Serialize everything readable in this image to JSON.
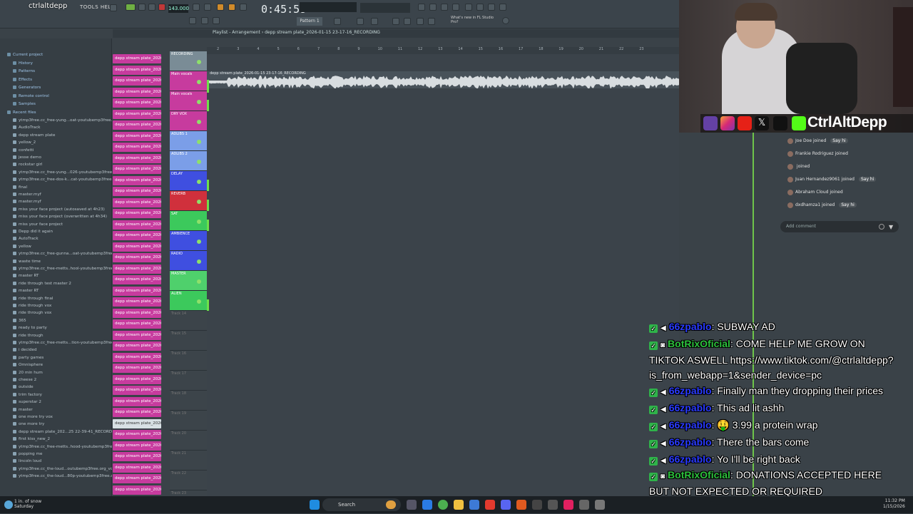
{
  "daw": {
    "logo": "ctrlaltdepp",
    "menu": "TOOLS  HELP",
    "tempo": "143.000",
    "time": "0:45:58",
    "pattern": "Pattern 1",
    "playlist_title": "Playlist - Arrangement › depp stream plate_2026-01-15 23-17-16_RECORDING",
    "news": "What's new in FL Studio Pro?"
  },
  "browser": {
    "folders": [
      "Current project",
      "History",
      "Patterns",
      "Effects",
      "Generators",
      "Remote control",
      "Samples",
      "Recent files"
    ],
    "files": [
      "ytmp3free.cc_free-yung...oat-youtubemp3free.org",
      "AudioTrack",
      "depp stream plate",
      "yellow_2",
      "confetti",
      "jesse demo",
      "rockstar girl",
      "ytmp3free.cc_free-yung...026-youtubemp3free.org",
      "ytmp3free.cc_free-dos-k...cat-youtubemp3free.org",
      "final",
      "master.myf",
      "master.myf",
      "miss your face project (autosaved at 4h23)",
      "miss your face project (overwritten at 4h34)",
      "miss your face project",
      "Depp did it again",
      "AutoTrack",
      "yellow",
      "ytmp3free.cc_free-gunna...oat-youtubemp3free.org",
      "waste time",
      "ytmp3free.cc_free-metts..hool-youtubemp3free.org",
      "master RT",
      "ride through test master 2",
      "master RT",
      "ride through final",
      "ride through vox",
      "ride through vox",
      "365",
      "ready to party",
      "ride through",
      "ytmp3free.cc_free-metts...tion-youtubemp3free.org",
      "i decided",
      "party games",
      "Omnisphere",
      "20 min hum",
      "cheese 2",
      "outside",
      "trim factory",
      "superstar 2",
      "master",
      "one more try vox",
      "one more try",
      "depp stream plate_202...25 22-39-41_RECORDING",
      "first kiss_new_2",
      "ytmp3free.cc_free-metts..hood-youtubemp3free.org",
      "popping me",
      "lincoln loud",
      "ytmp3free.cc_the-loud...outubemp3free.org_vocal",
      "ytmp3free.cc_the-loud...80p-youtubemp3free.org"
    ]
  },
  "clips": {
    "label": "depp stream plate_2026..."
  },
  "tracks": [
    {
      "name": "RECORDING",
      "color": "#7a8c96"
    },
    {
      "name": "Main vocals",
      "color": "#c73b9e"
    },
    {
      "name": "Main vocals",
      "color": "#c73b9e"
    },
    {
      "name": "DRY VOX",
      "color": "#c73b9e"
    },
    {
      "name": "ADLIBS 1",
      "color": "#7b9ee8"
    },
    {
      "name": "ADLIBS 2",
      "color": "#7b9ee8"
    },
    {
      "name": "DELAY",
      "color": "#3f4fe0"
    },
    {
      "name": "REVERB",
      "color": "#d0303c"
    },
    {
      "name": "SAT",
      "color": "#3cc95c"
    },
    {
      "name": "AMBIENCE",
      "color": "#3f4fe0"
    },
    {
      "name": "RADIO",
      "color": "#3f4fe0"
    },
    {
      "name": "MASTER",
      "color": "#4fd06c"
    },
    {
      "name": "ALIEN",
      "color": "#3cc95c"
    }
  ],
  "empty_tracks": [
    "Track 14",
    "Track 15",
    "Track 16",
    "Track 17",
    "Track 18",
    "Track 19",
    "Track 20",
    "Track 21",
    "Track 22",
    "Track 23"
  ],
  "bars": [
    "2",
    "3",
    "4",
    "5",
    "6",
    "7",
    "8",
    "9",
    "10",
    "11",
    "12",
    "13",
    "14",
    "15",
    "16",
    "17",
    "18",
    "19",
    "20",
    "21",
    "22",
    "23"
  ],
  "audio_clip": {
    "label": "depp stream plate_2026-01-15 23-17-16_RECORDING"
  },
  "stream": {
    "handle": "CtrlAltDepp",
    "tiktok_events": [
      {
        "user": "Joe Doe",
        "action": "joined",
        "say": "Say hi"
      },
      {
        "user": "Frankie Rodriguez",
        "action": "joined",
        "say": ""
      },
      {
        "user": "",
        "action": "joined",
        "say": ""
      },
      {
        "user": "Juan Hernandez9061",
        "action": "joined",
        "say": "Say hi"
      },
      {
        "user": "Abraham Cloud",
        "action": "joined",
        "say": ""
      },
      {
        "user": "dxdhamza1",
        "action": "joined",
        "say": "Say hi"
      }
    ],
    "add_comment": "Add comment",
    "chat": [
      {
        "user": "66zpablo",
        "text": ": SUBWAY AD",
        "bot": false
      },
      {
        "user": "BotRixOficial",
        "text": ": COME HELP ME GROW ON TIKTOK ASWELL https://www.tiktok.com/@ctrlaltdepp?is_from_webapp=1&sender_device=pc",
        "bot": true
      },
      {
        "user": "66zpablo",
        "text": ": Finally man they dropping their prices",
        "bot": false
      },
      {
        "user": "66zpablo",
        "text": ": This ad lit ashh",
        "bot": false
      },
      {
        "user": "66zpablo",
        "text": ": 🤑 3.99 a protein wrap",
        "bot": false
      },
      {
        "user": "66zpablo",
        "text": ": There the bars come",
        "bot": false
      },
      {
        "user": "66zpablo",
        "text": ": Yo I'll be right back",
        "bot": false
      },
      {
        "user": "BotRixOficial",
        "text": ": DONATIONS ACCEPTED HERE BUT NOT EXPECTED OR REQUIRED https://botrix.live/k/ctrlaltdepp/tip",
        "bot": true
      }
    ]
  },
  "taskbar": {
    "weather": "1 in. of snow",
    "weather_sub": "Saturday",
    "search": "Search",
    "time": "11:32 PM",
    "date": "1/15/2026"
  }
}
